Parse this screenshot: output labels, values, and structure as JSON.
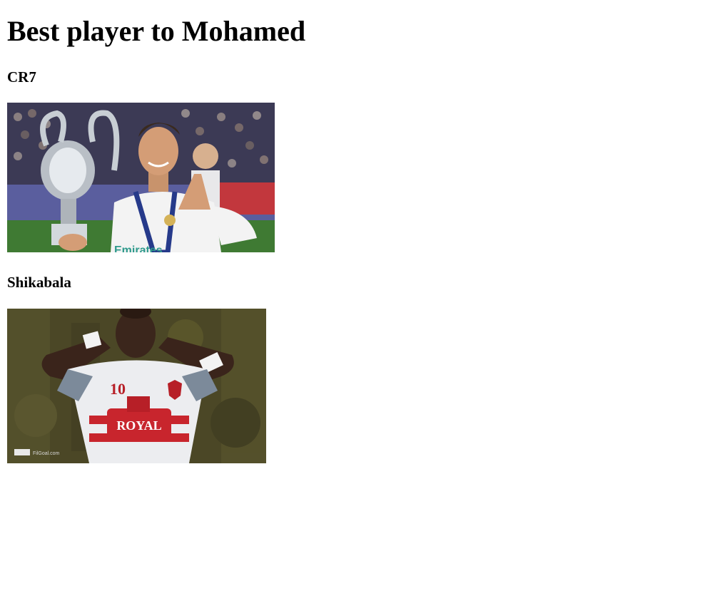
{
  "page": {
    "title": "Best player to Mohamed"
  },
  "players": [
    {
      "name": "CR7",
      "photo": {
        "kind": "photo",
        "shirt_text": "Emirates"
      }
    },
    {
      "name": "Shikabala",
      "photo": {
        "kind": "photo",
        "shirt_number": "10",
        "sponsor_text": "ROYAL",
        "watermark_text": "FilGoal.com"
      }
    }
  ]
}
